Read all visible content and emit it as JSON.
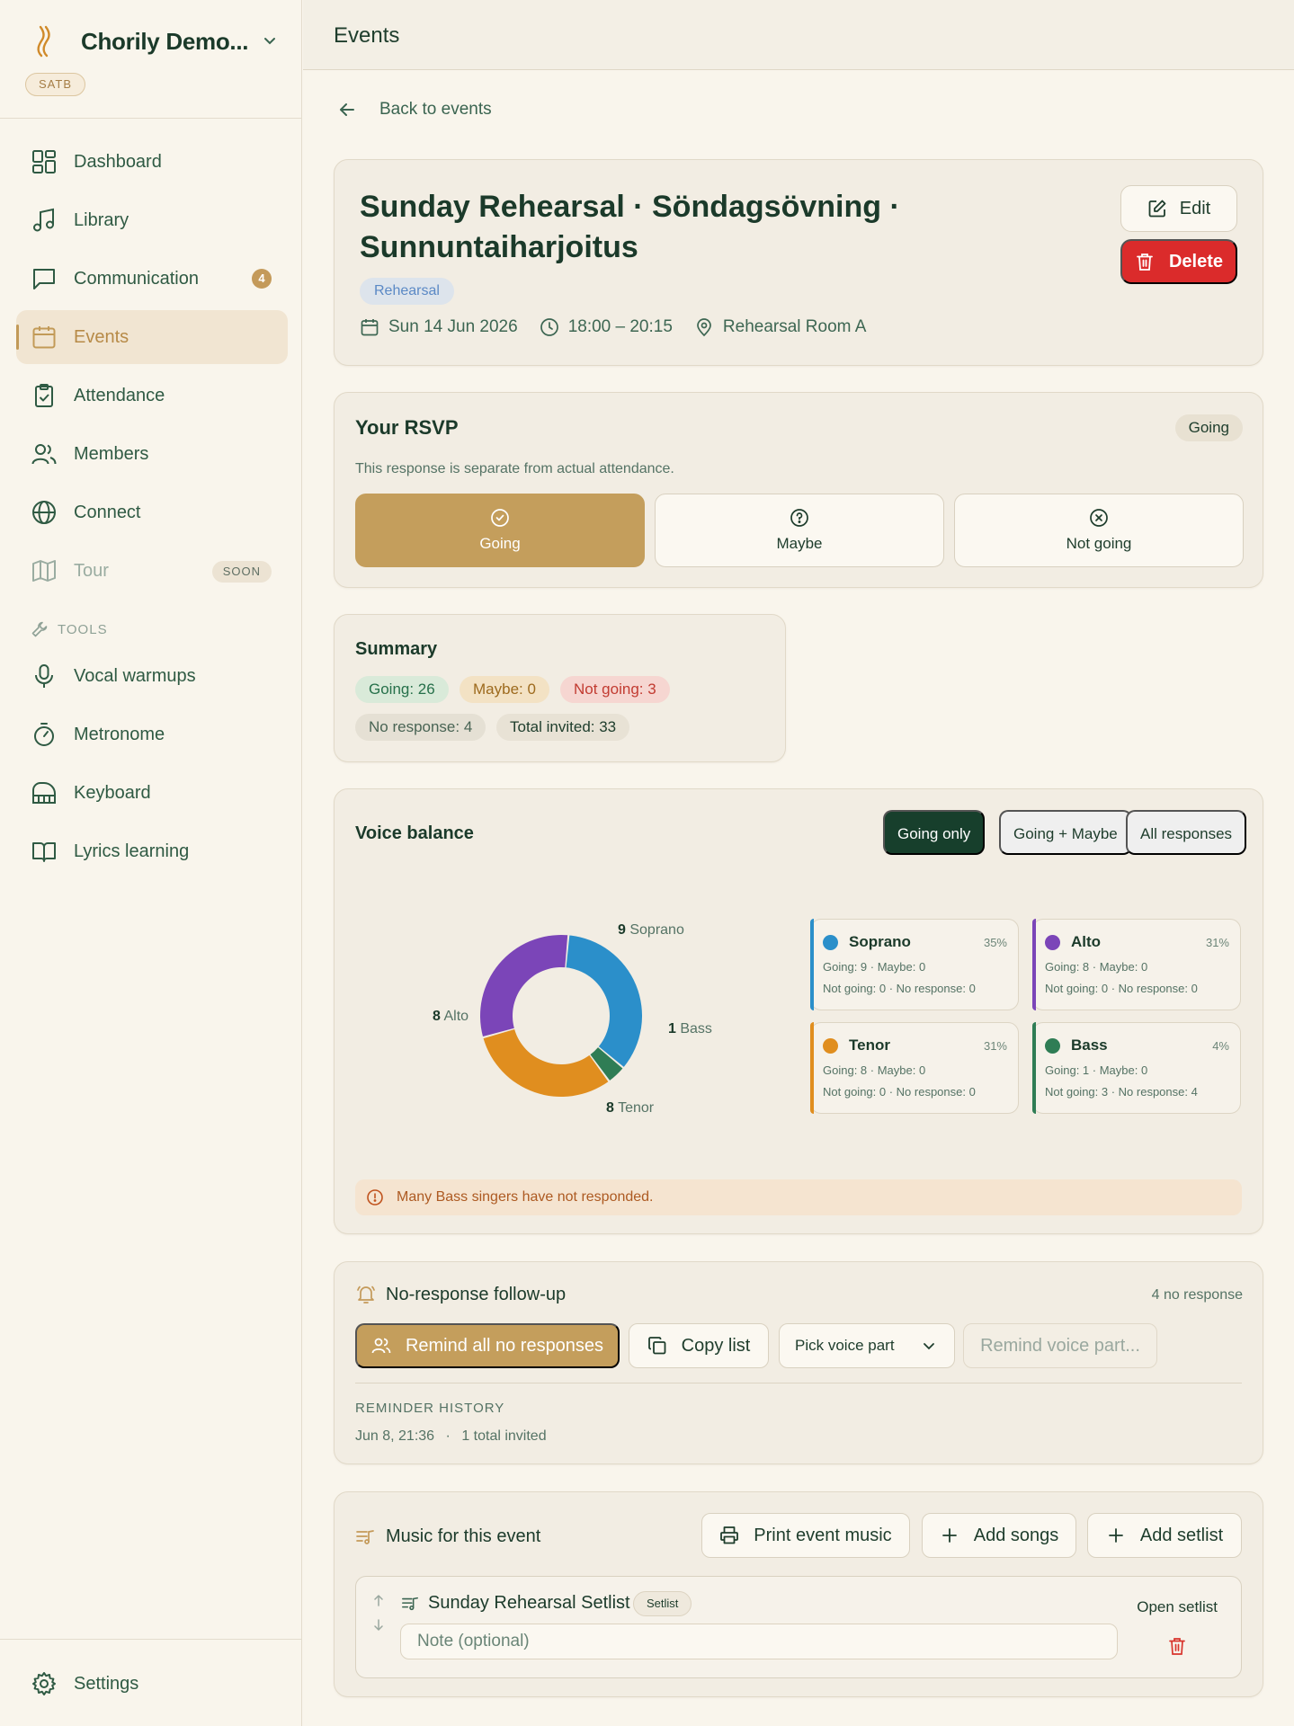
{
  "app": {
    "name": "Chorily Demo...",
    "badge": "SATB"
  },
  "nav": {
    "dashboard": "Dashboard",
    "library": "Library",
    "communication": "Communication",
    "communication_count": "4",
    "events": "Events",
    "attendance": "Attendance",
    "members": "Members",
    "connect": "Connect",
    "tour": "Tour",
    "tour_badge": "SOON",
    "tools_header": "TOOLS",
    "vocal_warmups": "Vocal warmups",
    "metronome": "Metronome",
    "keyboard": "Keyboard",
    "lyrics_learning": "Lyrics learning",
    "settings": "Settings"
  },
  "header": {
    "title": "Events"
  },
  "back_link": "Back to events",
  "event": {
    "title": "Sunday Rehearsal · Söndagsövning · Sunnuntaiharjoitus",
    "type": "Rehearsal",
    "date": "Sun 14 Jun 2026",
    "time": "18:00 – 20:15",
    "location": "Rehearsal Room A",
    "edit_label": "Edit",
    "delete_label": "Delete"
  },
  "rsvp": {
    "title": "Your RSVP",
    "status": "Going",
    "note": "This response is separate from actual attendance.",
    "options": {
      "going": "Going",
      "maybe": "Maybe",
      "not_going": "Not going"
    },
    "selected": "going"
  },
  "summary": {
    "title": "Summary",
    "going": "Going: 26",
    "maybe": "Maybe: 0",
    "not_going": "Not going: 3",
    "no_response": "No response: 4",
    "total": "Total invited: 33"
  },
  "voice_balance": {
    "title": "Voice balance",
    "filters": {
      "going_only": "Going only",
      "going_maybe": "Going + Maybe",
      "all": "All responses"
    },
    "active_filter": "going_only",
    "alert": "Many Bass singers have not responded.",
    "parts": [
      {
        "name": "Soprano",
        "count": "9",
        "pct": "35%",
        "line1": "Going: 9 · Maybe: 0",
        "line2": "Not going: 0 · No response: 0",
        "color": "#2b8fca"
      },
      {
        "name": "Alto",
        "count": "8",
        "pct": "31%",
        "line1": "Going: 8 · Maybe: 0",
        "line2": "Not going: 0 · No response: 0",
        "color": "#7b45b8"
      },
      {
        "name": "Tenor",
        "count": "8",
        "pct": "31%",
        "line1": "Going: 8 · Maybe: 0",
        "line2": "Not going: 0 · No response: 0",
        "color": "#e08e1f"
      },
      {
        "name": "Bass",
        "count": "1",
        "pct": "4%",
        "line1": "Going: 1 · Maybe: 0",
        "line2": "Not going: 3 · No response: 4",
        "color": "#2f7d55"
      }
    ]
  },
  "chart_data": {
    "type": "pie",
    "categories": [
      "Soprano",
      "Bass",
      "Tenor",
      "Alto"
    ],
    "values": [
      9,
      1,
      8,
      8
    ],
    "colors": [
      "#2b8fca",
      "#2f7d55",
      "#e08e1f",
      "#7b45b8"
    ]
  },
  "followup": {
    "title": "No-response follow-up",
    "count": "4 no response",
    "remind_all": "Remind all no responses",
    "copy_list": "Copy list",
    "pick_voice": "Pick voice part",
    "remind_voice": "Remind voice part...",
    "history_header": "REMINDER HISTORY",
    "history_date": "Jun 8, 21:36",
    "history_sep": "·",
    "history_detail": "1 total invited"
  },
  "music": {
    "title": "Music for this event",
    "print": "Print event music",
    "add_songs": "Add songs",
    "add_setlist": "Add setlist",
    "setlist_name": "Sunday Rehearsal Setlist",
    "setlist_badge": "Setlist",
    "note_placeholder": "Note (optional)",
    "open_setlist": "Open setlist"
  },
  "colors": {
    "accent": "#c49e5c",
    "primary_dark": "#173f2c",
    "danger": "#db2b2b"
  }
}
